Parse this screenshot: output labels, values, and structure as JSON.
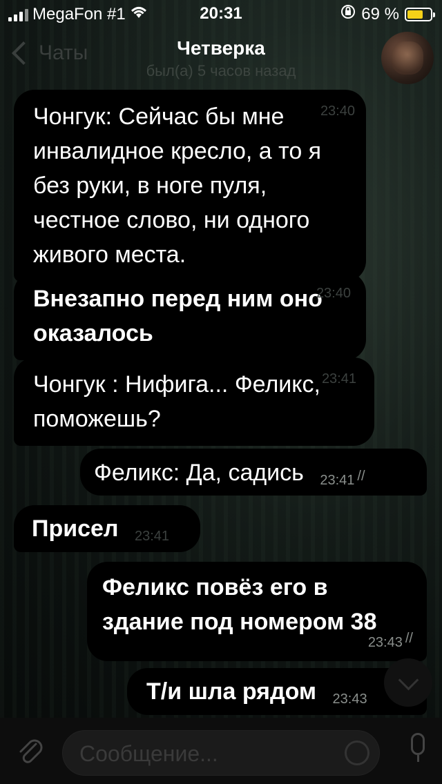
{
  "status": {
    "carrier": "MegaFon #1",
    "time": "20:31",
    "battery": "69 %",
    "battery_fill_percent": 69
  },
  "header": {
    "back_label": "Чаты",
    "title": "Четверка",
    "subtitle": "был(а) 5 часов назад"
  },
  "messages": [
    {
      "text": "Чонгук: Сейчас бы мне инвалидное кресло, а то я без руки, в ноге пуля, честное слово, ни одного живого места.",
      "time": "23:40",
      "direction": "incoming",
      "bold": false
    },
    {
      "text": "Внезапно перед ним оно оказалось",
      "time": "23:40",
      "direction": "incoming",
      "bold": true
    },
    {
      "text": "Чонгук : Нифига... Феликс, поможешь?",
      "time": "23:41",
      "direction": "incoming",
      "bold": false
    },
    {
      "text": "Феликс: Да, садись",
      "time": "23:41",
      "direction": "outgoing",
      "bold": false,
      "status": "read"
    },
    {
      "text": "Присел",
      "time": "23:41",
      "direction": "incoming",
      "bold": true
    },
    {
      "text": "Феликс повёз его в здание под номером 38",
      "time": "23:43",
      "direction": "outgoing",
      "bold": true,
      "status": "read"
    },
    {
      "text": "Т/и шла рядом",
      "time": "23:43",
      "direction": "outgoing",
      "bold": true
    }
  ],
  "composer": {
    "placeholder": "Сообщение..."
  },
  "icons": {
    "attach": "paperclip-icon",
    "sticker": "sticker-icon",
    "mic": "microphone-icon",
    "scroll_down": "chevron-down-icon",
    "read_check": "double-check-icon"
  },
  "colors": {
    "bubble": "#000000",
    "battery": "#f5d218",
    "time_text": "#3c413f"
  }
}
